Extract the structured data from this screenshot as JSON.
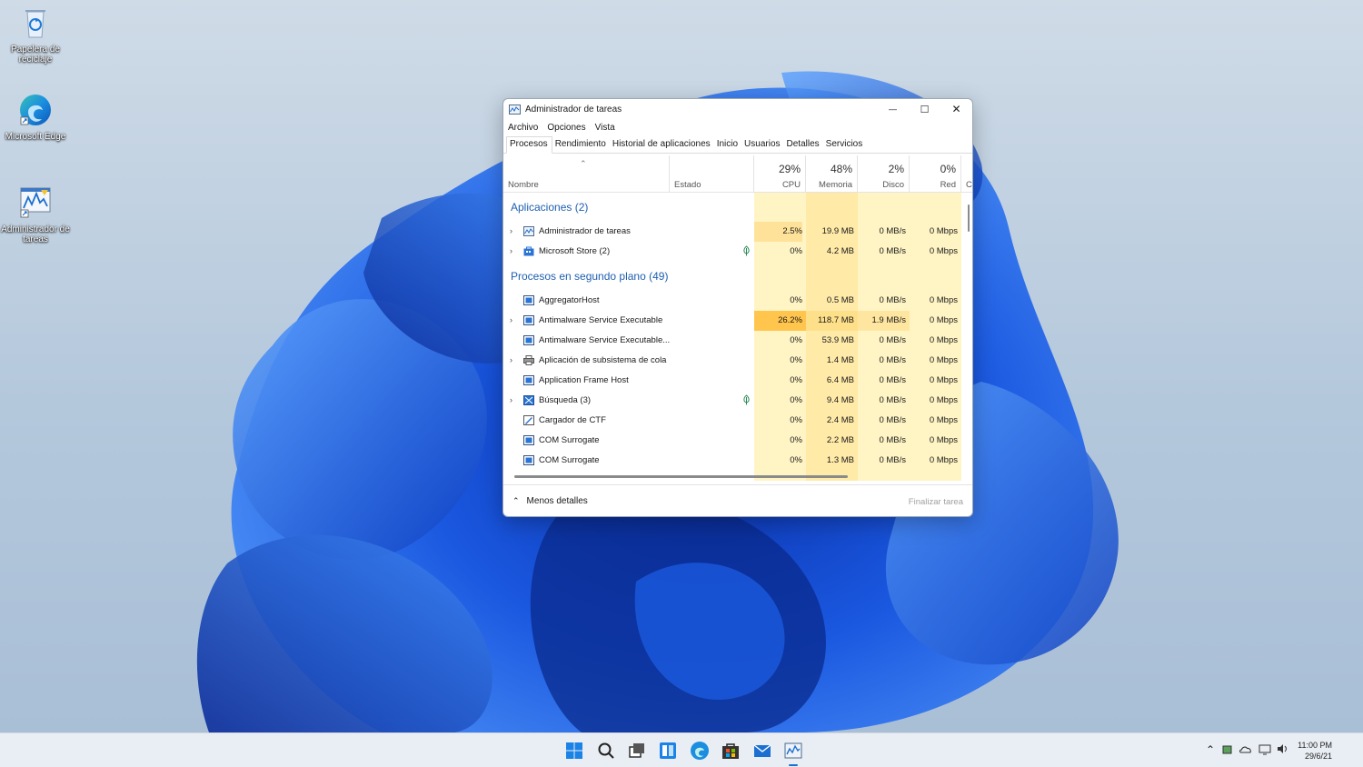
{
  "desktop": {
    "icons": [
      {
        "label": "Papelera de reciclaje",
        "icon": "recycle-bin-icon"
      },
      {
        "label": "Microsoft Edge",
        "icon": "edge-icon"
      },
      {
        "label": "Administrador de tareas",
        "icon": "task-manager-icon"
      }
    ]
  },
  "taskmgr": {
    "title": "Administrador de tareas",
    "controls": {
      "minimize": "—",
      "maximize": "☐",
      "close": "✕"
    },
    "menu": [
      "Archivo",
      "Opciones",
      "Vista"
    ],
    "tabs": [
      "Procesos",
      "Rendimiento",
      "Historial de aplicaciones",
      "Inicio",
      "Usuarios",
      "Detalles",
      "Servicios"
    ],
    "active_tab": "Procesos",
    "columns": {
      "name": "Nombre",
      "status": "Estado",
      "cpu": {
        "pct": "29%",
        "label": "CPU"
      },
      "memory": {
        "pct": "48%",
        "label": "Memoria"
      },
      "disk": {
        "pct": "2%",
        "label": "Disco"
      },
      "network": {
        "pct": "0%",
        "label": "Red"
      },
      "extra": "C"
    },
    "groups": {
      "apps": "Aplicaciones (2)",
      "background": "Procesos en segundo plano (49)"
    },
    "apps": [
      {
        "name": "Administrador de tareas",
        "cpu": "2.5%",
        "mem": "19.9 MB",
        "disk": "0 MB/s",
        "net": "0 Mbps"
      },
      {
        "name": "Microsoft Store (2)",
        "cpu": "0%",
        "mem": "4.2 MB",
        "disk": "0 MB/s",
        "net": "0 Mbps"
      }
    ],
    "background": [
      {
        "name": "AggregatorHost",
        "cpu": "0%",
        "mem": "0.5 MB",
        "disk": "0 MB/s",
        "net": "0 Mbps"
      },
      {
        "name": "Antimalware Service Executable",
        "cpu": "26.2%",
        "mem": "118.7 MB",
        "disk": "1.9 MB/s",
        "net": "0 Mbps"
      },
      {
        "name": "Antimalware Service Executable...",
        "cpu": "0%",
        "mem": "53.9 MB",
        "disk": "0 MB/s",
        "net": "0 Mbps"
      },
      {
        "name": "Aplicación de subsistema de cola",
        "cpu": "0%",
        "mem": "1.4 MB",
        "disk": "0 MB/s",
        "net": "0 Mbps"
      },
      {
        "name": "Application Frame Host",
        "cpu": "0%",
        "mem": "6.4 MB",
        "disk": "0 MB/s",
        "net": "0 Mbps"
      },
      {
        "name": "Búsqueda (3)",
        "cpu": "0%",
        "mem": "9.4 MB",
        "disk": "0 MB/s",
        "net": "0 Mbps"
      },
      {
        "name": "Cargador de CTF",
        "cpu": "0%",
        "mem": "2.4 MB",
        "disk": "0 MB/s",
        "net": "0 Mbps"
      },
      {
        "name": "COM Surrogate",
        "cpu": "0%",
        "mem": "2.2 MB",
        "disk": "0 MB/s",
        "net": "0 Mbps"
      },
      {
        "name": "COM Surrogate",
        "cpu": "0%",
        "mem": "1.3 MB",
        "disk": "0 MB/s",
        "net": "0 Mbps"
      }
    ],
    "footer": {
      "less_details": "Menos detalles",
      "end_task": "Finalizar tarea"
    }
  },
  "taskbar": {
    "clock_time": "11:00 PM",
    "clock_date": "29/6/21"
  },
  "colors": {
    "accent": "#1b6fd1",
    "heat_light": "#fff4c4",
    "heat_mid": "#ffeaa8",
    "heat_high": "#ffd16e",
    "group_text": "#1e5fb0"
  }
}
